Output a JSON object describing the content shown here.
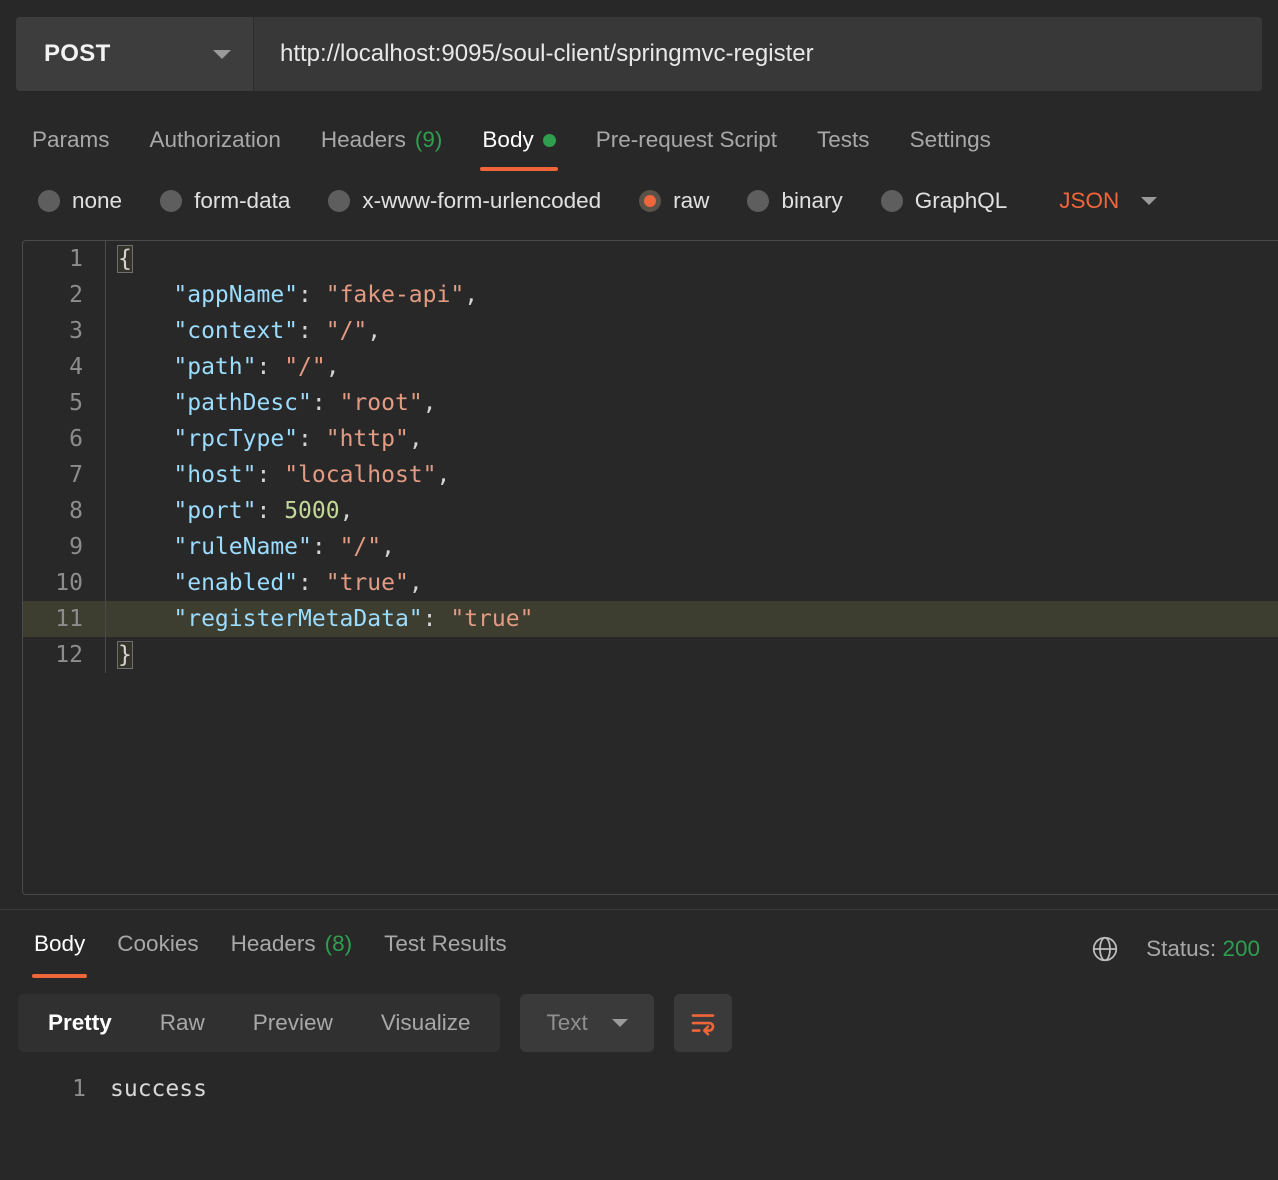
{
  "request": {
    "method": "POST",
    "url": "http://localhost:9095/soul-client/springmvc-register",
    "method_caret": "chevron-down-icon",
    "tabs": [
      {
        "label": "Params",
        "count": "",
        "active": false,
        "dot": false
      },
      {
        "label": "Authorization",
        "count": "",
        "active": false,
        "dot": false
      },
      {
        "label": "Headers",
        "count": "(9)",
        "active": false,
        "dot": false
      },
      {
        "label": "Body",
        "count": "",
        "active": true,
        "dot": true
      },
      {
        "label": "Pre-request Script",
        "count": "",
        "active": false,
        "dot": false
      },
      {
        "label": "Tests",
        "count": "",
        "active": false,
        "dot": false
      },
      {
        "label": "Settings",
        "count": "",
        "active": false,
        "dot": false
      }
    ],
    "body_types": [
      {
        "label": "none",
        "selected": false
      },
      {
        "label": "form-data",
        "selected": false
      },
      {
        "label": "x-www-form-urlencoded",
        "selected": false
      },
      {
        "label": "raw",
        "selected": true
      },
      {
        "label": "binary",
        "selected": false
      },
      {
        "label": "GraphQL",
        "selected": false
      }
    ],
    "format": "JSON"
  },
  "editor": {
    "lines": [
      {
        "num": "1",
        "active": false,
        "tokens": [
          {
            "t": "brace",
            "v": "{"
          }
        ]
      },
      {
        "num": "2",
        "active": false,
        "tokens": [
          {
            "t": "punc",
            "v": "    "
          },
          {
            "t": "key",
            "v": "\"appName\""
          },
          {
            "t": "punc",
            "v": ": "
          },
          {
            "t": "str",
            "v": "\"fake-api\""
          },
          {
            "t": "punc",
            "v": ","
          }
        ]
      },
      {
        "num": "3",
        "active": false,
        "tokens": [
          {
            "t": "punc",
            "v": "    "
          },
          {
            "t": "key",
            "v": "\"context\""
          },
          {
            "t": "punc",
            "v": ": "
          },
          {
            "t": "str",
            "v": "\"/\""
          },
          {
            "t": "punc",
            "v": ","
          }
        ]
      },
      {
        "num": "4",
        "active": false,
        "tokens": [
          {
            "t": "punc",
            "v": "    "
          },
          {
            "t": "key",
            "v": "\"path\""
          },
          {
            "t": "punc",
            "v": ": "
          },
          {
            "t": "str",
            "v": "\"/\""
          },
          {
            "t": "punc",
            "v": ","
          }
        ]
      },
      {
        "num": "5",
        "active": false,
        "tokens": [
          {
            "t": "punc",
            "v": "    "
          },
          {
            "t": "key",
            "v": "\"pathDesc\""
          },
          {
            "t": "punc",
            "v": ": "
          },
          {
            "t": "str",
            "v": "\"root\""
          },
          {
            "t": "punc",
            "v": ","
          }
        ]
      },
      {
        "num": "6",
        "active": false,
        "tokens": [
          {
            "t": "punc",
            "v": "    "
          },
          {
            "t": "key",
            "v": "\"rpcType\""
          },
          {
            "t": "punc",
            "v": ": "
          },
          {
            "t": "str",
            "v": "\"http\""
          },
          {
            "t": "punc",
            "v": ","
          }
        ]
      },
      {
        "num": "7",
        "active": false,
        "tokens": [
          {
            "t": "punc",
            "v": "    "
          },
          {
            "t": "key",
            "v": "\"host\""
          },
          {
            "t": "punc",
            "v": ": "
          },
          {
            "t": "str",
            "v": "\"localhost\""
          },
          {
            "t": "punc",
            "v": ","
          }
        ]
      },
      {
        "num": "8",
        "active": false,
        "tokens": [
          {
            "t": "punc",
            "v": "    "
          },
          {
            "t": "key",
            "v": "\"port\""
          },
          {
            "t": "punc",
            "v": ": "
          },
          {
            "t": "num",
            "v": "5000"
          },
          {
            "t": "punc",
            "v": ","
          }
        ]
      },
      {
        "num": "9",
        "active": false,
        "tokens": [
          {
            "t": "punc",
            "v": "    "
          },
          {
            "t": "key",
            "v": "\"ruleName\""
          },
          {
            "t": "punc",
            "v": ": "
          },
          {
            "t": "str",
            "v": "\"/\""
          },
          {
            "t": "punc",
            "v": ","
          }
        ]
      },
      {
        "num": "10",
        "active": false,
        "tokens": [
          {
            "t": "punc",
            "v": "    "
          },
          {
            "t": "key",
            "v": "\"enabled\""
          },
          {
            "t": "punc",
            "v": ": "
          },
          {
            "t": "str",
            "v": "\"true\""
          },
          {
            "t": "punc",
            "v": ","
          }
        ]
      },
      {
        "num": "11",
        "active": true,
        "tokens": [
          {
            "t": "punc",
            "v": "    "
          },
          {
            "t": "key",
            "v": "\"registerMetaData\""
          },
          {
            "t": "punc",
            "v": ": "
          },
          {
            "t": "str",
            "v": "\"true\""
          }
        ]
      },
      {
        "num": "12",
        "active": false,
        "tokens": [
          {
            "t": "brace",
            "v": "}"
          }
        ]
      }
    ]
  },
  "response": {
    "tabs": [
      {
        "label": "Body",
        "count": "",
        "active": true
      },
      {
        "label": "Cookies",
        "count": "",
        "active": false
      },
      {
        "label": "Headers",
        "count": "(8)",
        "active": false
      },
      {
        "label": "Test Results",
        "count": "",
        "active": false
      }
    ],
    "status_label": "Status:",
    "status_code": "200",
    "views": [
      {
        "label": "Pretty",
        "active": true
      },
      {
        "label": "Raw",
        "active": false
      },
      {
        "label": "Preview",
        "active": false
      },
      {
        "label": "Visualize",
        "active": false
      }
    ],
    "format": "Text",
    "wrap_icon": "word-wrap-icon",
    "globe_icon": "globe-icon",
    "body_lines": [
      {
        "num": "1",
        "text": "success"
      }
    ]
  },
  "colors": {
    "accent": "#f0663a",
    "success": "#2f9e4f",
    "json_key": "#9cdcfe",
    "json_string": "#e39b82",
    "json_number": "#c3d898"
  }
}
